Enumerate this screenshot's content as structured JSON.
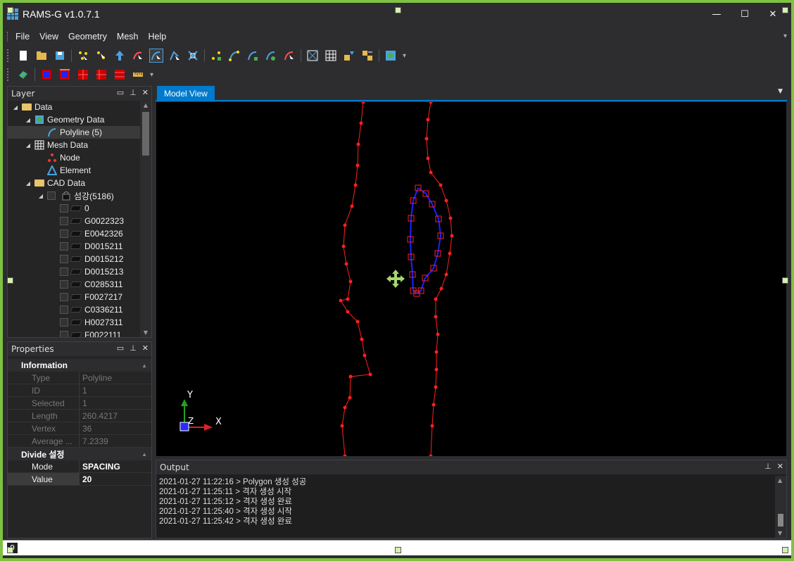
{
  "app": {
    "title": "RAMS-G v1.0.7.1"
  },
  "window": {
    "minimize": "—",
    "maximize": "☐",
    "close": "✕"
  },
  "menu": [
    {
      "label": "File"
    },
    {
      "label": "View"
    },
    {
      "label": "Geometry"
    },
    {
      "label": "Mesh"
    },
    {
      "label": "Help"
    }
  ],
  "layer_panel": {
    "title": "Layer",
    "tree": [
      {
        "label": "Data",
        "icon": "folder-open-icon"
      },
      {
        "label": "Geometry Data",
        "icon": "globe-icon"
      },
      {
        "label": "Polyline (5)",
        "icon": "polyline-icon"
      },
      {
        "label": "Mesh Data",
        "icon": "mesh-icon"
      },
      {
        "label": "Node",
        "icon": "node-icon"
      },
      {
        "label": "Element",
        "icon": "element-icon"
      },
      {
        "label": "CAD Data",
        "icon": "folder-open-icon"
      },
      {
        "label": "섬강(5186)",
        "icon": "cad-lock-icon"
      }
    ],
    "cad_layers": [
      "0",
      "G0022323",
      "E0042326",
      "D0015211",
      "D0015212",
      "D0015213",
      "C0285311",
      "F0027217",
      "C0336211",
      "H0027311",
      "F0022111"
    ]
  },
  "properties_panel": {
    "title": "Properties",
    "information": {
      "title": "Information",
      "rows": [
        {
          "k": "Type",
          "v": "Polyline"
        },
        {
          "k": "ID",
          "v": "1"
        },
        {
          "k": "Selected",
          "v": "1"
        },
        {
          "k": "Length",
          "v": "260.4217"
        },
        {
          "k": "Vertex",
          "v": "36"
        },
        {
          "k": "Average ...",
          "v": "7.2339"
        }
      ]
    },
    "divide": {
      "title": "Divide 설정",
      "rows": [
        {
          "k": "Mode",
          "v": "SPACING"
        },
        {
          "k": "Value",
          "v": "20"
        }
      ]
    }
  },
  "model_view": {
    "tab": "Model View",
    "axis_x": "X",
    "axis_y": "Y",
    "axis_z": "Z"
  },
  "output": {
    "title": "Output",
    "lines": [
      "2021-01-27 11:22:16 > Polygon 생성 성공",
      "2021-01-27 11:25:11 > 격자 생성 시작",
      "2021-01-27 11:25:12 > 격자 생성 완료",
      "2021-01-27 11:25:40 > 격자 생성 시작",
      "2021-01-27 11:25:42 > 격자 생성 완료"
    ]
  },
  "status": {
    "count": "0"
  },
  "colors": {
    "accent": "#007acc",
    "frame": "#7fc241",
    "polyline": "#ff2020",
    "mesh": "#2020ff",
    "move_cursor": "#a6d86b"
  }
}
